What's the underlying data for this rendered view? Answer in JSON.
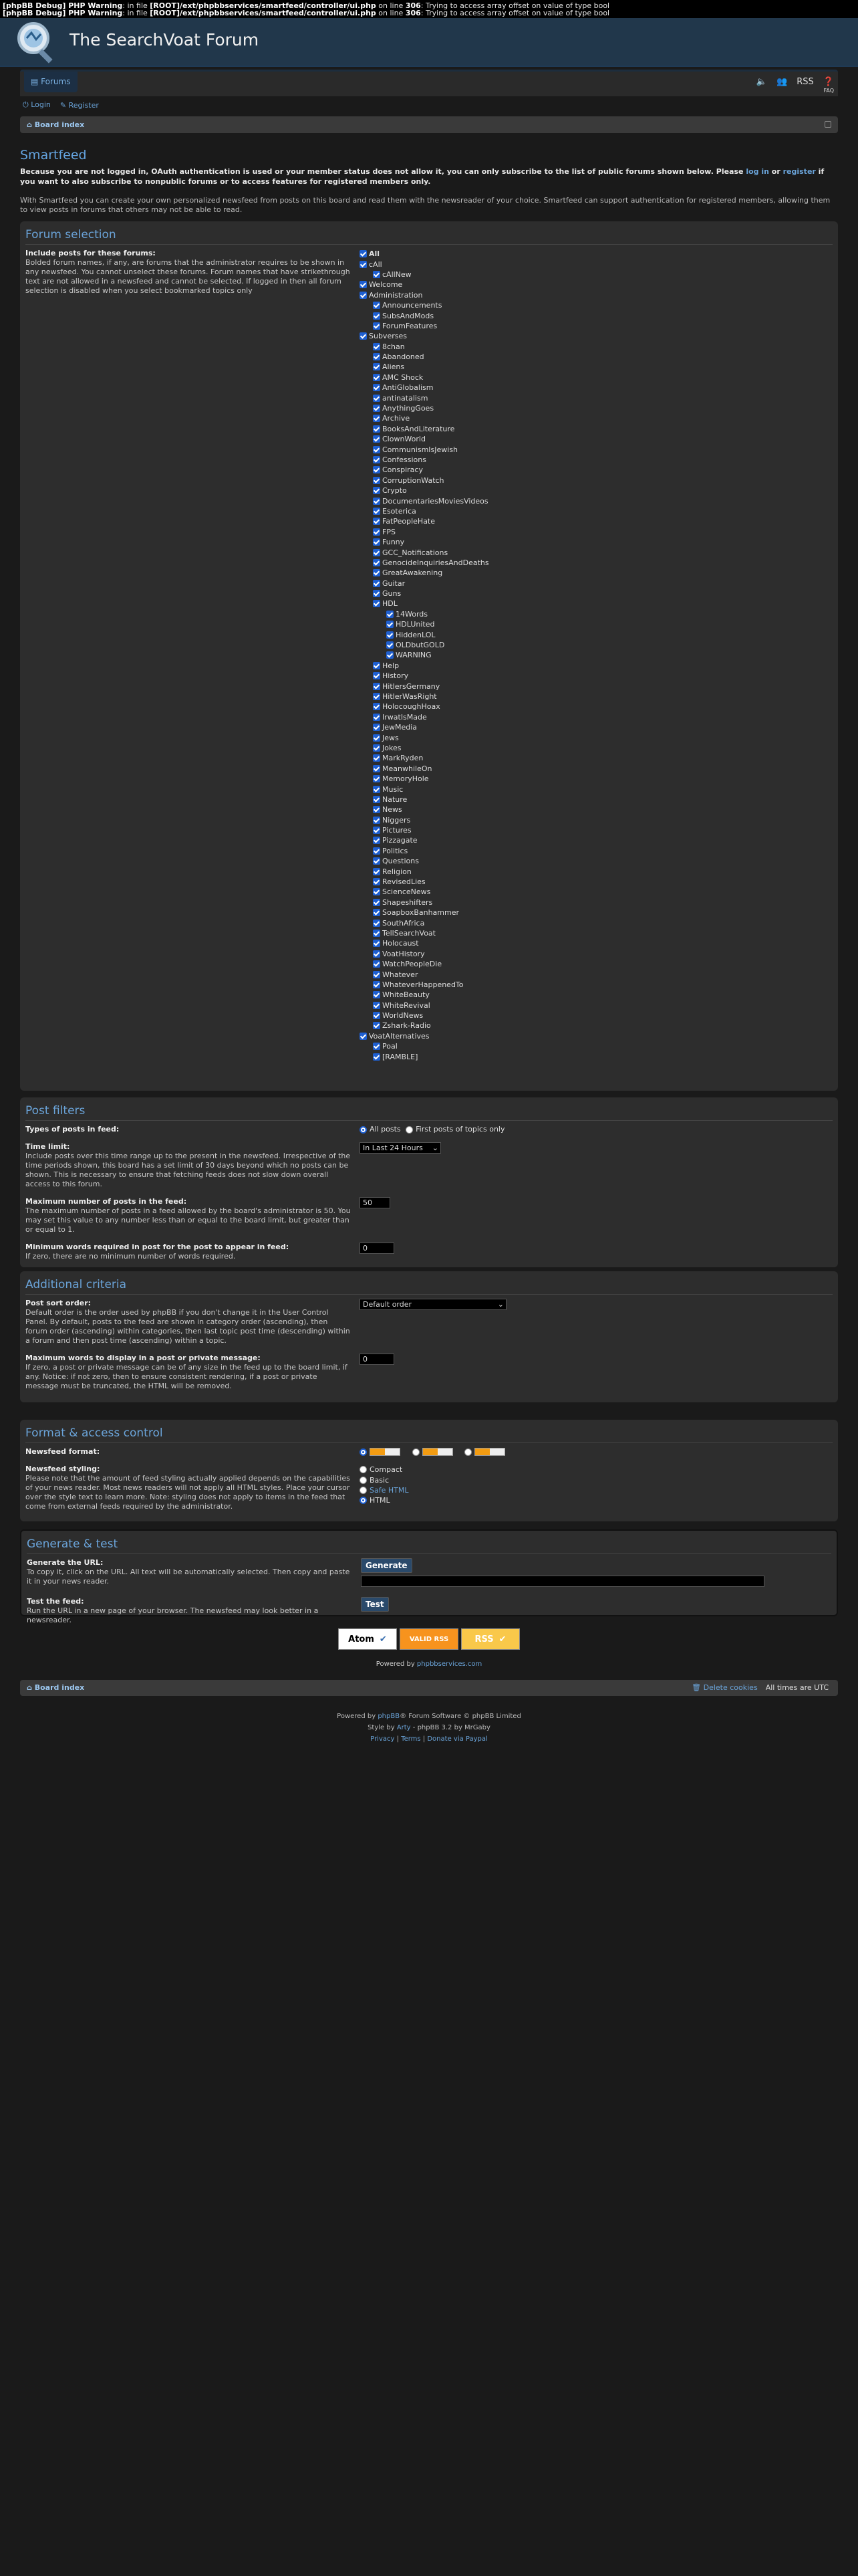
{
  "debug": {
    "line1_prefix": "[phpBB Debug] PHP Warning",
    "line1_mid": ": in file ",
    "line1_file": "[ROOT]/ext/phpbbservices/smartfeed/controller/ui.php",
    "line1_online": " on line ",
    "line1_num": "306",
    "line1_msg": ": Trying to access array offset on value of type bool"
  },
  "site": {
    "title": "The SearchVoat Forum"
  },
  "nav": {
    "forums": "Forums",
    "rss": "RSS",
    "faq": "FAQ"
  },
  "auth": {
    "login": "Login",
    "register": "Register"
  },
  "breadcrumb": {
    "board_index": "Board index"
  },
  "page": {
    "title": "Smartfeed",
    "intro_a": "Because you are not logged in, OAuth authentication is used or your member status does not allow it, you can only subscribe to the list of public forums shown below. Please ",
    "intro_login": "log in",
    "intro_or": " or ",
    "intro_register": "register",
    "intro_b": " if you want to also subscribe to nonpublic forums or to access features for registered members only.",
    "intro2": "With Smartfeed you can create your own personalized newsfeed from posts on this board and read them with the newsreader of your choice. Smartfeed can support authentication for registered members, allowing them to view posts in forums that others may not be able to read."
  },
  "forum_selection": {
    "heading": "Forum selection",
    "label": "Include posts for these forums:",
    "explain": "Bolded forum names, if any, are forums that the administrator requires to be shown in any newsfeed. You cannot unselect these forums. Forum names that have strikethrough text are not allowed in a newsfeed and cannot be selected. If logged in then all forum selection is disabled when you select bookmarked topics only",
    "all": "All",
    "items": [
      {
        "name": "cAll",
        "lvl": 0
      },
      {
        "name": "cAllNew",
        "lvl": 1
      },
      {
        "name": "Welcome",
        "lvl": 0
      },
      {
        "name": "Administration",
        "lvl": 0
      },
      {
        "name": "Announcements",
        "lvl": 1
      },
      {
        "name": "SubsAndMods",
        "lvl": 1
      },
      {
        "name": "ForumFeatures",
        "lvl": 1
      },
      {
        "name": "Subverses",
        "lvl": 0
      },
      {
        "name": "8chan",
        "lvl": 1
      },
      {
        "name": "Abandoned",
        "lvl": 1
      },
      {
        "name": "Aliens",
        "lvl": 1
      },
      {
        "name": "AMC Shock",
        "lvl": 1
      },
      {
        "name": "AntiGlobalism",
        "lvl": 1
      },
      {
        "name": "antinatalism",
        "lvl": 1
      },
      {
        "name": "AnythingGoes",
        "lvl": 1
      },
      {
        "name": "Archive",
        "lvl": 1
      },
      {
        "name": "BooksAndLiterature",
        "lvl": 1
      },
      {
        "name": "ClownWorld",
        "lvl": 1
      },
      {
        "name": "CommunismIsJewish",
        "lvl": 1
      },
      {
        "name": "Confessions",
        "lvl": 1
      },
      {
        "name": "Conspiracy",
        "lvl": 1
      },
      {
        "name": "CorruptionWatch",
        "lvl": 1
      },
      {
        "name": "Crypto",
        "lvl": 1
      },
      {
        "name": "DocumentariesMoviesVideos",
        "lvl": 1
      },
      {
        "name": "Esoterica",
        "lvl": 1
      },
      {
        "name": "FatPeopleHate",
        "lvl": 1
      },
      {
        "name": "FPS",
        "lvl": 1
      },
      {
        "name": "Funny",
        "lvl": 1
      },
      {
        "name": "GCC_Notifications",
        "lvl": 1
      },
      {
        "name": "GenocideInquiriesAndDeaths",
        "lvl": 1
      },
      {
        "name": "GreatAwakening",
        "lvl": 1
      },
      {
        "name": "Guitar",
        "lvl": 1
      },
      {
        "name": "Guns",
        "lvl": 1
      },
      {
        "name": "HDL",
        "lvl": 1
      },
      {
        "name": "14Words",
        "lvl": 2
      },
      {
        "name": "HDLUnited",
        "lvl": 2
      },
      {
        "name": "HiddenLOL",
        "lvl": 2
      },
      {
        "name": "OLDbutGOLD",
        "lvl": 2
      },
      {
        "name": "WARNING",
        "lvl": 2
      },
      {
        "name": "Help",
        "lvl": 1
      },
      {
        "name": "History",
        "lvl": 1
      },
      {
        "name": "HitlersGermany",
        "lvl": 1
      },
      {
        "name": "HitlerWasRight",
        "lvl": 1
      },
      {
        "name": "HolocoughHoax",
        "lvl": 1
      },
      {
        "name": "IrwatIsMade",
        "lvl": 1
      },
      {
        "name": "JewMedia",
        "lvl": 1
      },
      {
        "name": "Jews",
        "lvl": 1
      },
      {
        "name": "Jokes",
        "lvl": 1
      },
      {
        "name": "MarkRyden",
        "lvl": 1
      },
      {
        "name": "MeanwhileOn",
        "lvl": 1
      },
      {
        "name": "MemoryHole",
        "lvl": 1
      },
      {
        "name": "Music",
        "lvl": 1
      },
      {
        "name": "Nature",
        "lvl": 1
      },
      {
        "name": "News",
        "lvl": 1
      },
      {
        "name": "Niggers",
        "lvl": 1
      },
      {
        "name": "Pictures",
        "lvl": 1
      },
      {
        "name": "Pizzagate",
        "lvl": 1
      },
      {
        "name": "Politics",
        "lvl": 1
      },
      {
        "name": "Questions",
        "lvl": 1
      },
      {
        "name": "Religion",
        "lvl": 1
      },
      {
        "name": "RevisedLies",
        "lvl": 1
      },
      {
        "name": "ScienceNews",
        "lvl": 1
      },
      {
        "name": "Shapeshifters",
        "lvl": 1
      },
      {
        "name": "SoapboxBanhammer",
        "lvl": 1
      },
      {
        "name": "SouthAfrica",
        "lvl": 1
      },
      {
        "name": "TellSearchVoat",
        "lvl": 1
      },
      {
        "name": "Holocaust",
        "lvl": 1
      },
      {
        "name": "VoatHistory",
        "lvl": 1
      },
      {
        "name": "WatchPeopleDie",
        "lvl": 1
      },
      {
        "name": "Whatever",
        "lvl": 1
      },
      {
        "name": "WhateverHappenedTo",
        "lvl": 1
      },
      {
        "name": "WhiteBeauty",
        "lvl": 1
      },
      {
        "name": "WhiteRevival",
        "lvl": 1
      },
      {
        "name": "WorldNews",
        "lvl": 1
      },
      {
        "name": "Zshark-Radio",
        "lvl": 1
      },
      {
        "name": "VoatAlternatives",
        "lvl": 0
      },
      {
        "name": "Poal",
        "lvl": 1
      },
      {
        "name": "[RAMBLE]",
        "lvl": 1
      }
    ]
  },
  "post_filters": {
    "heading": "Post filters",
    "types_label": "Types of posts in feed:",
    "types_all": "All posts",
    "types_first": "First posts of topics only",
    "time_label": "Time limit:",
    "time_explain": "Include posts over this time range up to the present in the newsfeed. Irrespective of the time periods shown, this board has a set limit of 30 days beyond which no posts can be shown. This is necessary to ensure that fetching feeds does not slow down overall access to this forum.",
    "time_value": "In Last 24 Hours",
    "max_label": "Maximum number of posts in the feed:",
    "max_explain": "The maximum number of posts in a feed allowed by the board's administrator is 50. You may set this value to any number less than or equal to the board limit, but greater than or equal to 1.",
    "max_value": "50",
    "minwords_label": "Minimum words required in post for the post to appear in feed:",
    "minwords_explain": "If zero, there are no minimum number of words required.",
    "minwords_value": "0"
  },
  "additional": {
    "heading": "Additional criteria",
    "sort_label": "Post sort order:",
    "sort_explain": "Default order is the order used by phpBB if you don't change it in the User Control Panel. By default, posts to the feed are shown in category order (ascending), then forum order (ascending) within categories, then last topic post time (descending) within a forum and then post time (ascending) within a topic.",
    "sort_value": "Default order",
    "maxwords_label": "Maximum words to display in a post or private message:",
    "maxwords_explain": "If zero, a post or private message can be of any size in the feed up to the board limit, if any. Notice: if not zero, then to ensure consistent rendering, if a post or private message must be truncated, the HTML will be removed.",
    "maxwords_value": "0"
  },
  "format": {
    "heading": "Format & access control",
    "nf_label": "Newsfeed format:",
    "style_label": "Newsfeed styling:",
    "style_explain": "Please note that the amount of feed styling actually applied depends on the capabilities of your news reader. Most news readers will not apply all HTML styles. Place your cursor over the style text to learn more. Note: styling does not apply to items in the feed that come from external feeds required by the administrator.",
    "style_opts": [
      "Compact",
      "Basic",
      "Safe HTML",
      "HTML"
    ]
  },
  "generate": {
    "heading": "Generate & test",
    "gen_label": "Generate the URL:",
    "gen_explain": "To copy it, click on the URL. All text will be automatically selected. Then copy and paste it in your news reader.",
    "gen_button": "Generate",
    "test_label": "Test the feed:",
    "test_explain": "Run the URL in a new page of your browser. The newsfeed may look better in a newsreader.",
    "test_button": "Test"
  },
  "badges": {
    "atom": "Atom",
    "valid": "VALID RSS",
    "rss": "RSS"
  },
  "powered_by": {
    "prefix": "Powered by ",
    "link": "phpbbservices.com"
  },
  "footer": {
    "board_index": "Board index",
    "delete_cookies": "Delete cookies",
    "timezone": "All times are UTC",
    "powered_prefix": "Powered by ",
    "phpbb": "phpBB",
    "powered_suffix": "® Forum Software © phpBB Limited",
    "style_prefix": "Style by ",
    "style_author": "Arty",
    "style_suffix": " - phpBB 3.2 by MrGaby",
    "privacy": "Privacy",
    "terms": "Terms",
    "donate": "Donate via Paypal"
  },
  "colors": {
    "accent": "#6aa3d8",
    "header": "#21374b",
    "checkbox": "#1e5fd1"
  }
}
